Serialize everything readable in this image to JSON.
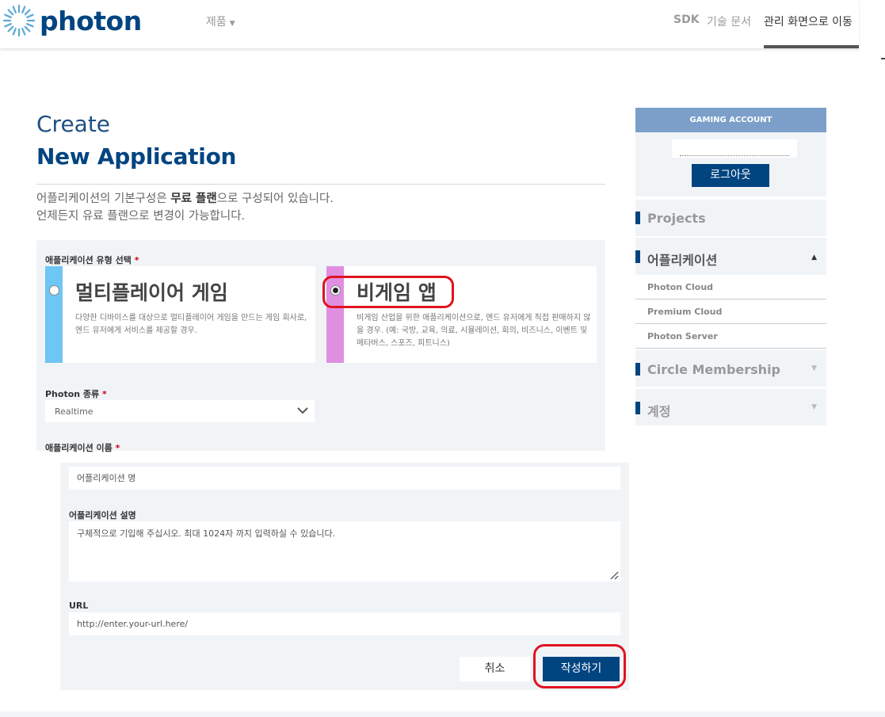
{
  "header": {
    "logo_text": "photon",
    "nav_products": "제품",
    "nav_sdk": "SDK",
    "nav_docs": "기술 문서",
    "nav_manage": "관리 화면으로 이동"
  },
  "page": {
    "title_create": "Create",
    "title_new_app": "New Application",
    "intro_prefix": "어플리케이션의 기본구성은 ",
    "intro_bold": "무료 플랜",
    "intro_suffix": "으로 구성되어 있습니다.",
    "intro_line2": "언제든지 유료 플랜으로 변경이 가능합니다."
  },
  "form": {
    "app_type_label": "애플리케이션 유형 선택",
    "required_mark": "*",
    "options": [
      {
        "title": "멀티플레이어 게임",
        "description": "다양한 디바이스를 대상으로 멀티플레이어 게임을 만드는 게임 회사로, 엔드 유저에게 서비스를 제공할 경우.",
        "checked": false,
        "color": "#6ec6f4"
      },
      {
        "title": "비게임 앱",
        "description": "비게임 산업을 위한 애플리케이션으로, 엔드 유저에게 직접 판매하지 않을 경우. (예: 국방, 교육, 의료, 시뮬레이션, 회의, 비즈니스, 이벤트 및 메타버스, 스포즈, 피트니스)",
        "checked": true,
        "color": "#e08fe0"
      }
    ],
    "photon_type_label": "Photon 종류",
    "photon_type_value": "Realtime",
    "app_name_label": "애플리케이션 이름",
    "app_name_placeholder": "어플리케이션 명",
    "app_desc_label": "어플리케이션 설명",
    "app_desc_placeholder": "구체적으로 기입해 주십시오. 최대 1024자 까지 입력하실 수 있습니다.",
    "url_label": "URL",
    "url_placeholder": "http://enter.your-url.here/",
    "cancel_label": "취소",
    "submit_label": "작성하기"
  },
  "sidebar": {
    "account_header": "GAMING ACCOUNT",
    "logout_label": "로그아웃",
    "items": [
      {
        "label": "Projects",
        "arrow": ""
      },
      {
        "label": "어플리케이션",
        "arrow": "▲"
      },
      {
        "label": "Circle Membership",
        "arrow": "▼"
      },
      {
        "label": "계정",
        "arrow": "▼"
      }
    ],
    "sub_items": [
      "Photon Cloud",
      "Premium Cloud",
      "Photon Server"
    ]
  },
  "colors": {
    "brand": "#004480",
    "highlight": "#e0131f",
    "panel": "#f1f4f7"
  }
}
